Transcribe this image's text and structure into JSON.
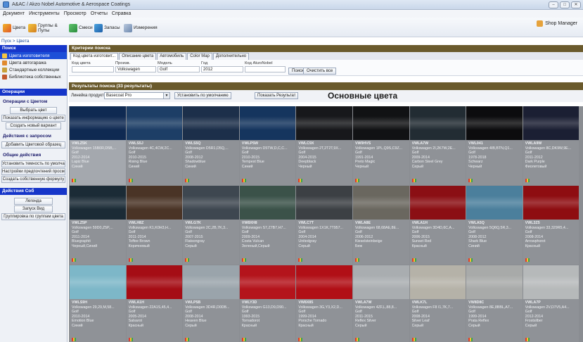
{
  "window": {
    "title": "A&AC / Akzo Nobel Automotive & Aerospace Coatings",
    "user": "Shop Manager",
    "controls": [
      "–",
      "□",
      "✕"
    ]
  },
  "menu": [
    "Документ",
    "Инструменты",
    "Просмотр",
    "Отчеты",
    "Справка"
  ],
  "toolbar": {
    "colors": "Цвета",
    "groups": "Группы & Пулы",
    "mixes": "Смеси",
    "stock": "Запасы",
    "measurements": "Измерения"
  },
  "breadcrumb": "Пуск > Цвета",
  "left_panel": {
    "search_header": "Поиск",
    "nav_items": [
      "Цвета изготовителя",
      "Цвета автогаража",
      "Стандартные коллекции",
      "Библиотека собственных"
    ],
    "operations_header": "Операции",
    "color_ops_title": "Операции с Цветом",
    "color_ops": [
      "Выбрать цвет",
      "Показать информацию о цвете",
      "Создать новый вариант"
    ],
    "request_ops_title": "Действия с запросом",
    "request_ops": [
      "Добавить Цветовой образец"
    ],
    "general_ops_title": "Общие действия",
    "general_ops": [
      "Установить темность по умолчанию",
      "Настройки предпочтений просмотра",
      "Создать собственную формулу"
    ],
    "groups_header": "Действия Соб",
    "group_ops": [
      "Легенда",
      "Запуск Вид",
      "Группировка по группам цвета"
    ]
  },
  "criteria": {
    "header": "Критерии поиска",
    "tabs": [
      "Код цвета изготовит...",
      "Описание цвета",
      "Автомобиль",
      "Color Map",
      "Дополнительно"
    ],
    "fields": {
      "code_label": "Код цвета",
      "code_value": "",
      "make_label": "Произв.",
      "make_value": "Volkswagen",
      "model_label": "Модель",
      "model_value": "Golf",
      "year_label": "Год",
      "year_value": "2012",
      "akzo_label": "Код AkzoNobel",
      "akzo_value": ""
    },
    "search_button": "Поиск",
    "clear_button": "Очистить все"
  },
  "results": {
    "header": "Результаты поиска  (33 результаты)",
    "filter_label": "Линейка продуктов",
    "filter_value": "Basecoat Pro",
    "default_button": "Установить по умолчанию",
    "show_button": "Показать Результат",
    "section_title": "Основные цвета"
  },
  "colors": [
    {
      "swatch": "#0f2a52",
      "code": "VWLZ5K",
      "desc": "Volkswagen 15B0R,D5B,...",
      "model": "Golf",
      "years": "2012-2014",
      "name": "Lapiz Blue",
      "family": "Синий"
    },
    {
      "swatch": "#1d3e66",
      "code": "VWLS5J",
      "desc": "Volkswagen 4C,4CW,2C...",
      "model": "Golf",
      "years": "2010-2015",
      "name": "Rising Blue",
      "family": "Синий"
    },
    {
      "swatch": "#1c2f4a",
      "code": "VWLS5Q",
      "desc": "Volkswagen D5R1,D5Q,...",
      "model": "Golf",
      "years": "2008-2012",
      "name": "Shadowblue",
      "family": "Синий"
    },
    {
      "swatch": "#15355e",
      "code": "VWLP5W",
      "desc": "Volkswagen D5TW,D,C,C...",
      "model": "Golf",
      "years": "2010-2015",
      "name": "Tempest Blue",
      "family": "Синий"
    },
    {
      "swatch": "#17181b",
      "code": "VWLC9X",
      "desc": "Volkswagen 2T,2T2T,9X...",
      "model": "Golf",
      "years": "2004-2015",
      "name": "Deepblack",
      "family": "Черный"
    },
    {
      "swatch": "#111214",
      "code": "VW9HVS",
      "desc": "Volkswagen 1PL,Q9S,C9Z...",
      "model": "Golf",
      "years": "1991-2014",
      "name": "Preto Magic",
      "family": "Черный"
    },
    {
      "swatch": "#222c33",
      "code": "VWLA7W",
      "desc": "Volkswagen 2I,2K7W,2E...",
      "model": "Golf",
      "years": "2009-2014",
      "name": "Carbon Steel Grey",
      "family": "Серый"
    },
    {
      "swatch": "#0c0c0e",
      "code": "VWL041",
      "desc": "Volkswagen 4IB,BTN,Q1...",
      "model": "Golf",
      "years": "1978-2018",
      "name": "Schwarz",
      "family": "Черный"
    },
    {
      "swatch": "#1b1f33",
      "code": "VWLA9W",
      "desc": "Volkswagen 8C,DK9W,9E...",
      "model": "Golf",
      "years": "2011-2012",
      "name": "Dark Purple",
      "family": "Фиолетовый"
    },
    {
      "swatch": "#1b2b36",
      "code": "VWLZ5P",
      "desc": "Volkswagen 59D0,Z5P,...",
      "model": "Golf",
      "years": "2011-2014",
      "name": "Bluegraphit",
      "family": "Черный,Синий"
    },
    {
      "swatch": "#4a3426",
      "code": "VWLH8Z",
      "desc": "Volkswagen K1,K0H3,H...",
      "model": "Golf",
      "years": "2011-2014",
      "name": "Toffee Brown",
      "family": "Коричневый"
    },
    {
      "swatch": "#3e4750",
      "code": "VWLG7K",
      "desc": "Volkswagen 2C,2B,7K,3...",
      "model": "Golf",
      "years": "2007-2015",
      "name": "Flatsongray",
      "family": "Серый"
    },
    {
      "swatch": "#3b5249",
      "code": "VW8XH8",
      "desc": "Volkswagen S7,Z7B7,H7...",
      "model": "Golf",
      "years": "2009-2014",
      "name": "Costa Vulcan",
      "family": "Зеленый,Серый"
    },
    {
      "swatch": "#3c4044",
      "code": "VWLC7T",
      "desc": "Volkswagen 1X1K,7T957...",
      "model": "Golf",
      "years": "2004-2014",
      "name": "Unitedgray",
      "family": "Серый"
    },
    {
      "swatch": "#6a675f",
      "code": "VWLA8E",
      "desc": "Volkswagen 68,68AE,8E...",
      "model": "Golf",
      "years": "2006-2012",
      "name": "Kieselsteinbeige",
      "family": "Беж"
    },
    {
      "swatch": "#8b0f14",
      "code": "VWLA1H",
      "desc": "Volkswagen 3D4D,6C,A...",
      "model": "Golf",
      "years": "2006-2015",
      "name": "Sunset Red",
      "family": "Красный"
    },
    {
      "swatch": "#4b7f9c",
      "code": "VWLA5Q",
      "desc": "Volkswagen 5Q6Q,5R,3...",
      "model": "Golf",
      "years": "2008-2012",
      "name": "Shark Blue",
      "family": "Синий"
    },
    {
      "swatch": "#8e0d11",
      "code": "VWL3Z5",
      "desc": "Volkswagen 33,329R5,4...",
      "model": "Golf",
      "years": "2008-2014",
      "name": "Arrowphorot",
      "family": "Красный"
    },
    {
      "swatch": "#7db7c8",
      "code": "VWLS9H",
      "desc": "Volkswagen 29,29,M,58...",
      "model": "Golf",
      "years": "2010-2014",
      "name": "Emotion Blue",
      "family": "Синий"
    },
    {
      "swatch": "#a50d15",
      "code": "VWLA1H",
      "desc": "Volkswagen 22A1S,45,4...",
      "model": "Golf",
      "years": "2005-2014",
      "name": "Salsarot",
      "family": "Красный"
    },
    {
      "swatch": "#9aa4ab",
      "code": "VWLP5B",
      "desc": "Volkswagen 3D4R,D0DB...",
      "model": "Golf",
      "years": "2008-2014",
      "name": "Heaven Blue",
      "family": "Серый"
    },
    {
      "swatch": "#b4141c",
      "code": "VWLY3D",
      "desc": "Volkswagen G13,D9,D90...",
      "model": "Golf",
      "years": "1993-2015",
      "name": "Tornadorot",
      "family": "Красный"
    },
    {
      "swatch": "#b10f16",
      "code": "VW8X85",
      "desc": "Volkswagen 3G,Y3,X2,D...",
      "model": "Golf",
      "years": "1999-2014",
      "name": "Porsche Tornado",
      "family": "Красный"
    },
    {
      "swatch": "#a9adb0",
      "code": "VWLA7W",
      "desc": "Volkswagen 4ZF,L,88,8...",
      "model": "Golf",
      "years": "2011-2015",
      "name": "Reflex Silver",
      "family": "Серый"
    },
    {
      "swatch": "#b5b2a8",
      "code": "VWLK7L",
      "desc": "Volkswagen F8 I1,7K,7...",
      "model": "Golf",
      "years": "2008-2014",
      "name": "Silver Leaf",
      "family": "Серый"
    },
    {
      "swatch": "#a8aaa9",
      "code": "VW8D8C",
      "desc": "Volkswagen 8E,8BBL,A7...",
      "model": "Golf",
      "years": "1999-2014",
      "name": "Prata Reflex",
      "family": "Серый"
    },
    {
      "swatch": "#b6b9ba",
      "code": "VWLA7P",
      "desc": "Volkswagen 2V,D7V5,A4...",
      "model": "Golf",
      "years": "2012-2014",
      "name": "Frostsilber",
      "family": "Серый"
    }
  ]
}
